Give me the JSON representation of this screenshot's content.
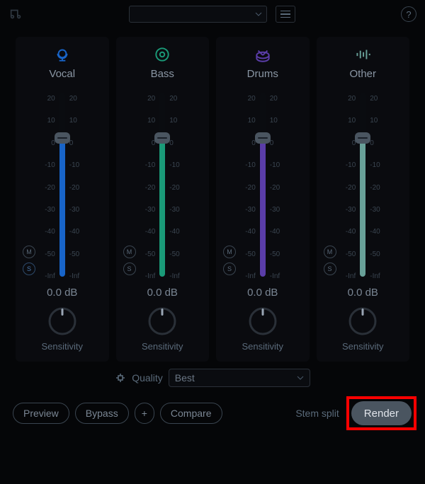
{
  "channels": [
    {
      "name": "Vocal",
      "db": "0.0 dB",
      "sens": "Sensitivity",
      "color": "#1864c8",
      "iconColor": "#1864c8",
      "soloActive": true
    },
    {
      "name": "Bass",
      "db": "0.0 dB",
      "sens": "Sensitivity",
      "color": "#1a9a78",
      "iconColor": "#1a9a78",
      "soloActive": false
    },
    {
      "name": "Drums",
      "db": "0.0 dB",
      "sens": "Sensitivity",
      "color": "#5a3da8",
      "iconColor": "#5a3da8",
      "soloActive": false
    },
    {
      "name": "Other",
      "db": "0.0 dB",
      "sens": "Sensitivity",
      "color": "#68a098",
      "iconColor": "#68a098",
      "soloActive": false
    }
  ],
  "scaleLeft": [
    "20",
    "10",
    "0",
    "-10",
    "-20",
    "-30",
    "-40",
    "-50",
    "-Inf"
  ],
  "scaleRight": [
    "20",
    "10",
    "0",
    "-10",
    "-20",
    "-30",
    "-40",
    "-50",
    "-Inf"
  ],
  "quality": {
    "label": "Quality",
    "value": "Best"
  },
  "buttons": {
    "preview": "Preview",
    "bypass": "Bypass",
    "plus": "+",
    "compare": "Compare",
    "stemSplit": "Stem split",
    "render": "Render"
  },
  "muteLabel": "M",
  "soloLabel": "S"
}
